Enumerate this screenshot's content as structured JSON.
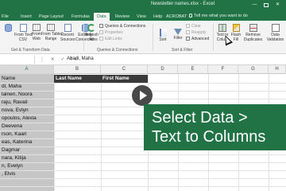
{
  "window": {
    "doc_title": "Newsletter names.xlsx  -  Excel",
    "min_glyph": "—",
    "close_glyph": "✕"
  },
  "tabs": [
    {
      "label": "File"
    },
    {
      "label": "Insert"
    },
    {
      "label": "Page Layout"
    },
    {
      "label": "Formulas"
    },
    {
      "label": "Data",
      "active": true
    },
    {
      "label": "Review"
    },
    {
      "label": "View"
    },
    {
      "label": "Help"
    },
    {
      "label": "ACROBAT"
    }
  ],
  "tell_me": "Tell me what you want to do",
  "ribbon": {
    "get_data": {
      "line1": "",
      "line2": ""
    },
    "from_text_csv": {
      "line1": "From Text/",
      "line2": "CSV"
    },
    "from_web": {
      "line1": "From",
      "line2": "Web"
    },
    "from_table": {
      "line1": "From Table/",
      "line2": "Range"
    },
    "recent_sources": {
      "line1": "Recent",
      "line2": "Sources"
    },
    "existing_connections": {
      "line1": "Existing",
      "line2": "Connections"
    },
    "refresh_all": {
      "line1": "Refresh",
      "line2": "All"
    },
    "queries_connections": "Queries & Connections",
    "properties": "Properties",
    "edit_links": "Edit Links",
    "sort": "Sort",
    "filter": "Filter",
    "clear": "Clear",
    "reapply": "Reapply",
    "advanced": "Advanced",
    "text_to_columns": {
      "line1": "Text to",
      "line2": "Colu..."
    },
    "flash_fill": {
      "line1": "Flash",
      "line2": "Fill"
    },
    "remove_duplicates": {
      "line1": "Remove",
      "line2": "Duplicates"
    },
    "data_validation": {
      "line1": "Data",
      "line2": "Validation"
    },
    "groups": {
      "get_transform": "Get & Transform Data",
      "queries_connections": "Queries & Connections",
      "sort_filter": "Sort & Filter"
    }
  },
  "formula_bar": {
    "controls": "⋮ ✕ ✓ fx",
    "value": "Abadi, Maha"
  },
  "columns": [
    "A",
    "B",
    "C",
    "D",
    "E",
    "F",
    "G",
    "H"
  ],
  "header_row": {
    "col_A": "Name",
    "col_B": "Last Name",
    "col_C": "First Name"
  },
  "column_a_values": [
    "di, Maha",
    "lainen, Noora",
    "raju, Ravali",
    "nova, Evlyn",
    "opoulos, Alexia",
    "Deevena",
    "rson, Kaari",
    "eas, Katerina",
    "Dagmar",
    "nara, Kitija",
    "n, Evelyn",
    ", Elvis"
  ],
  "callout": {
    "line1": "Select Data >",
    "line2": "Text to Columns"
  },
  "colors": {
    "excel_green": "#217346",
    "callout_bg": "#217346",
    "header_row_bg": "#3a3a3a",
    "selected_column_bg": "#c6c6c6"
  }
}
